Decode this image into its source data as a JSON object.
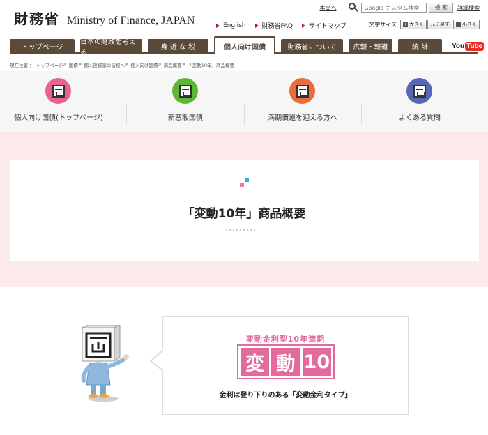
{
  "header": {
    "logo_kanji": "財務省",
    "logo_en": "Ministry of Finance, JAPAN",
    "skip_link": "本文へ",
    "search_placeholder": "Google カスタム検索",
    "search_button": "検 索",
    "advanced_search": "詳細検索",
    "links": [
      "English",
      "財務省FAQ",
      "サイトマップ"
    ],
    "font_size_label": "文字サイズ",
    "font_sizes": [
      {
        "mark": "+",
        "label": "大きく"
      },
      {
        "mark": "",
        "label": "元に戻す"
      },
      {
        "mark": "−",
        "label": "小さく"
      }
    ]
  },
  "nav": {
    "tabs": [
      "トップページ",
      "日本の財政を考える",
      "身 近 な 税",
      "個人向け国債",
      "財務省について",
      "広報・報道",
      "統 計"
    ],
    "active_index": 3,
    "youtube": {
      "you": "You",
      "tube": "Tube"
    }
  },
  "breadcrumb": {
    "prefix": "現在位置 ：",
    "items": [
      "トップページ",
      "国債",
      "個人投資家の皆様へ",
      "個人向け国債",
      "商品概要"
    ],
    "current": "「変動10年」商品概要"
  },
  "local_nav": [
    {
      "label": "個人向け国債(トップページ)",
      "color": "#e8648e"
    },
    {
      "label": "新窓販国債",
      "color": "#5db634"
    },
    {
      "label": "満期償還を迎える方へ",
      "color": "#ec6a3c"
    },
    {
      "label": "よくある質問",
      "color": "#5567b5"
    }
  ],
  "main": {
    "title": "「変動10年」商品概要",
    "product_subhead": "変動金利型10年満期",
    "product_chars": [
      "変",
      "動",
      "10"
    ],
    "bubble_text": "金利は登り下りのある「変動金利タイプ」"
  },
  "colors": {
    "brown": "#5b4a3a",
    "pink_bg": "#fbe9ec",
    "product_pink": "#e36a9d"
  }
}
